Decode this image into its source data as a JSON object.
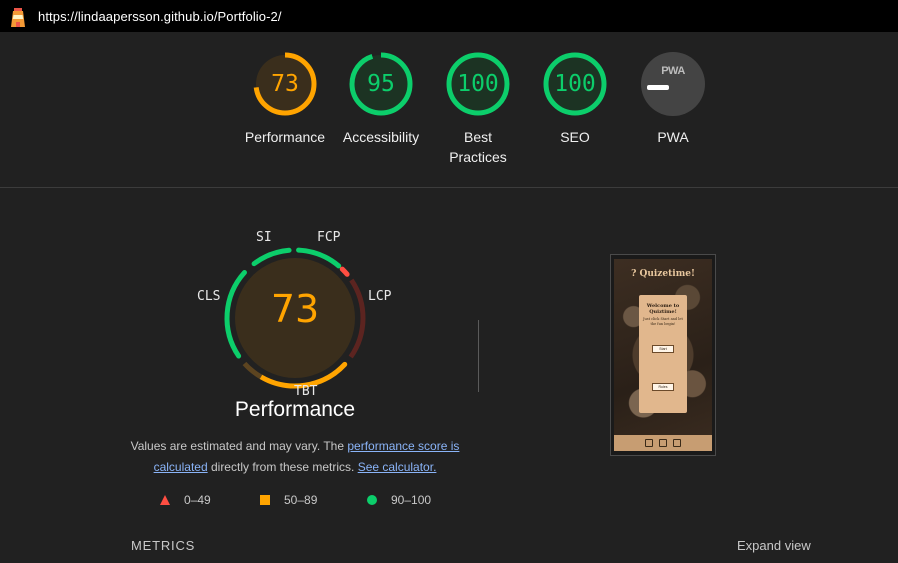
{
  "browser": {
    "url": "https://lindaapersson.github.io/Portfolio-2/"
  },
  "colors": {
    "fail": "#ff4e42",
    "average": "#ffa400",
    "pass": "#0cce6b",
    "na": "#757575"
  },
  "categories": [
    {
      "label": "Performance",
      "score": "73",
      "value": 0.73,
      "color": "#ffa400"
    },
    {
      "label": "Accessibility",
      "score": "95",
      "value": 0.95,
      "color": "#0cce6b"
    },
    {
      "label": "Best\nPractices",
      "label_line1": "Best",
      "label_line2": "Practices",
      "score": "100",
      "value": 1.0,
      "color": "#0cce6b"
    },
    {
      "label": "SEO",
      "score": "100",
      "value": 1.0,
      "color": "#0cce6b"
    },
    {
      "label": "PWA",
      "badge": "PWA",
      "score": "—",
      "value": 0,
      "color": "#757575"
    }
  ],
  "performance": {
    "score": "73",
    "title": "Performance",
    "metric_labels": {
      "si": "SI",
      "fcp": "FCP",
      "lcp": "LCP",
      "tbt": "TBT",
      "cls": "CLS"
    },
    "description": {
      "part1": "Values are estimated and may vary. The ",
      "link1": "performance score is calculated",
      "part2": " directly from these metrics. ",
      "link2": "See calculator."
    },
    "legend": [
      {
        "icon": "fail-triangle-icon",
        "range": "0–49"
      },
      {
        "icon": "average-square-icon",
        "range": "50–89"
      },
      {
        "icon": "pass-circle-icon",
        "range": "90–100"
      }
    ]
  },
  "thumbnail": {
    "header": "? Quizetime!",
    "card_title": "Welcome to Quiztime!",
    "card_text": "Just click Start and let the fun begin!",
    "start_label": "Start",
    "rules_label": "Rules"
  },
  "metrics_section": {
    "title": "METRICS",
    "expand_label": "Expand view"
  }
}
